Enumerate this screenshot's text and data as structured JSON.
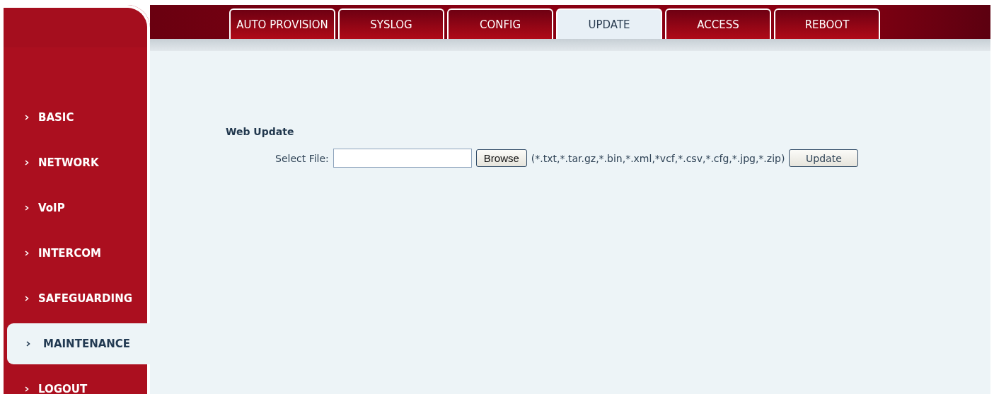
{
  "tabs": [
    {
      "label": "AUTO PROVISION",
      "selected": false
    },
    {
      "label": "SYSLOG",
      "selected": false
    },
    {
      "label": "CONFIG",
      "selected": false
    },
    {
      "label": "UPDATE",
      "selected": true
    },
    {
      "label": "ACCESS",
      "selected": false
    },
    {
      "label": "REBOOT",
      "selected": false
    }
  ],
  "sidebar": {
    "items": [
      {
        "label": "BASIC",
        "selected": false
      },
      {
        "label": "NETWORK",
        "selected": false
      },
      {
        "label": "VoIP",
        "selected": false
      },
      {
        "label": "INTERCOM",
        "selected": false
      },
      {
        "label": "SAFEGUARDING",
        "selected": false
      },
      {
        "label": "MAINTENANCE",
        "selected": true
      },
      {
        "label": "LOGOUT",
        "selected": false
      }
    ]
  },
  "section": {
    "title": "Web Update",
    "field_label": "Select File:",
    "browse_button": "Browse",
    "file_types": "(*.txt,*.tar.gz,*.bin,*.xml,*vcf,*.csv,*.cfg,*.jpg,*.zip)",
    "update_button": "Update"
  }
}
